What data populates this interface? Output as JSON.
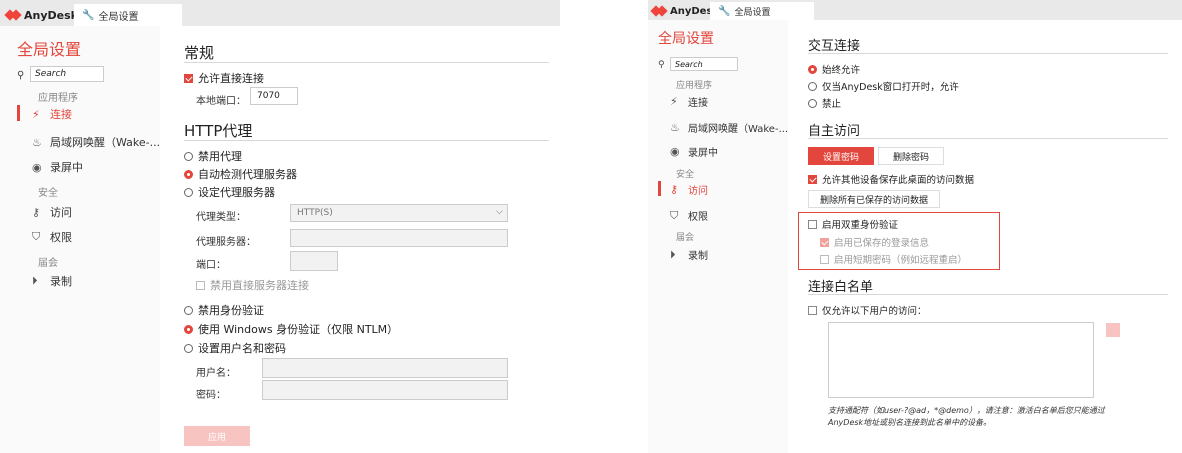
{
  "left": {
    "brand": "AnyDesk",
    "tab_label": "全局设置",
    "sidebar": {
      "title": "全局设置",
      "search_text": "Search",
      "category_app": "应用程序",
      "nav_connect": "连接",
      "nav_wol": "局域网唤醒（Wake-...",
      "nav_recording": "录屏中",
      "category_security": "安全",
      "nav_access": "访问",
      "nav_permissions": "权限",
      "category_session": "届会",
      "nav_record": "录制"
    },
    "general": {
      "heading": "常规",
      "allow_direct": "允许直接连接",
      "local_port_label": "本地端口：",
      "local_port_value": "7070"
    },
    "http_proxy": {
      "heading": "HTTP代理",
      "opt_disable": "禁用代理",
      "opt_auto": "自动检测代理服务器",
      "opt_set": "设定代理服务器",
      "proxy_type_label": "代理类型：",
      "proxy_type_value": "HTTP(S)",
      "proxy_server_label": "代理服务器：",
      "port_label": "端口：",
      "disable_direct": "禁用直接服务器连接",
      "auth_disable": "禁用身份验证",
      "auth_windows": "使用 Windows 身份验证（仅限 NTLM）",
      "auth_userpass": "设置用户名和密码",
      "username_label": "用户名：",
      "password_label": "密码：",
      "apply_button": "应用"
    }
  },
  "right": {
    "brand": "AnyDesk",
    "tab_label": "全局设置",
    "sidebar": {
      "title": "全局设置",
      "search_text": "Search",
      "category_app": "应用程序",
      "nav_connect": "连接",
      "nav_wol": "局域网唤醒（Wake-...",
      "nav_recording": "录屏中",
      "category_security": "安全",
      "nav_access": "访问",
      "nav_permissions": "权限",
      "category_session": "届会",
      "nav_record": "录制"
    },
    "interactive": {
      "heading": "交互连接",
      "opt_always": "始终允许",
      "opt_window_open": "仅当AnyDesk窗口打开时，允许",
      "opt_disable": "禁止"
    },
    "unattended": {
      "heading": "自主访问",
      "set_password": "设置密码",
      "delete_password": "删除密码",
      "allow_save": "允许其他设备保存此桌面的访问数据",
      "delete_all": "删除所有已保存的访问数据",
      "enable_2fa": "启用双重身份验证",
      "enable_saved_login": "启用已保存的登录信息",
      "enable_short_pw": "启用短期密码（例如远程重启）"
    },
    "whitelist": {
      "heading": "连接白名单",
      "only_allow": "仅允许以下用户的访问：",
      "note_line1": "支持通配符（如user-?@ad，*@demo），请注意：激活白名单后您只能通过",
      "note_line2": "AnyDesk地址或别名连接到此名单中的设备。"
    }
  }
}
